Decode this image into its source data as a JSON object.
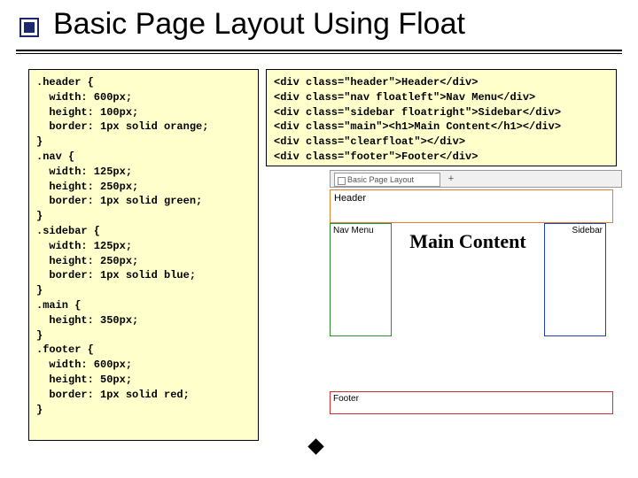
{
  "title": "Basic Page Layout Using Float",
  "css_code": ".header {\n  width: 600px;\n  height: 100px;\n  border: 1px solid orange;\n}\n.nav {\n  width: 125px;\n  height: 250px;\n  border: 1px solid green;\n}\n.sidebar {\n  width: 125px;\n  height: 250px;\n  border: 1px solid blue;\n}\n.main {\n  height: 350px;\n}\n.footer {\n  width: 600px;\n  height: 50px;\n  border: 1px solid red;\n}",
  "html_code": "<div class=\"header\">Header</div>\n<div class=\"nav floatleft\">Nav Menu</div>\n<div class=\"sidebar floatright\">Sidebar</div>\n<div class=\"main\"><h1>Main Content</h1></div>\n<div class=\"clearfloat\"></div>\n<div class=\"footer\">Footer</div>",
  "mockup": {
    "tab_label": "Basic Page Layout",
    "plus": "+",
    "header": "Header",
    "nav": "Nav Menu",
    "sidebar": "Sidebar",
    "main": "Main Content",
    "footer": "Footer"
  }
}
